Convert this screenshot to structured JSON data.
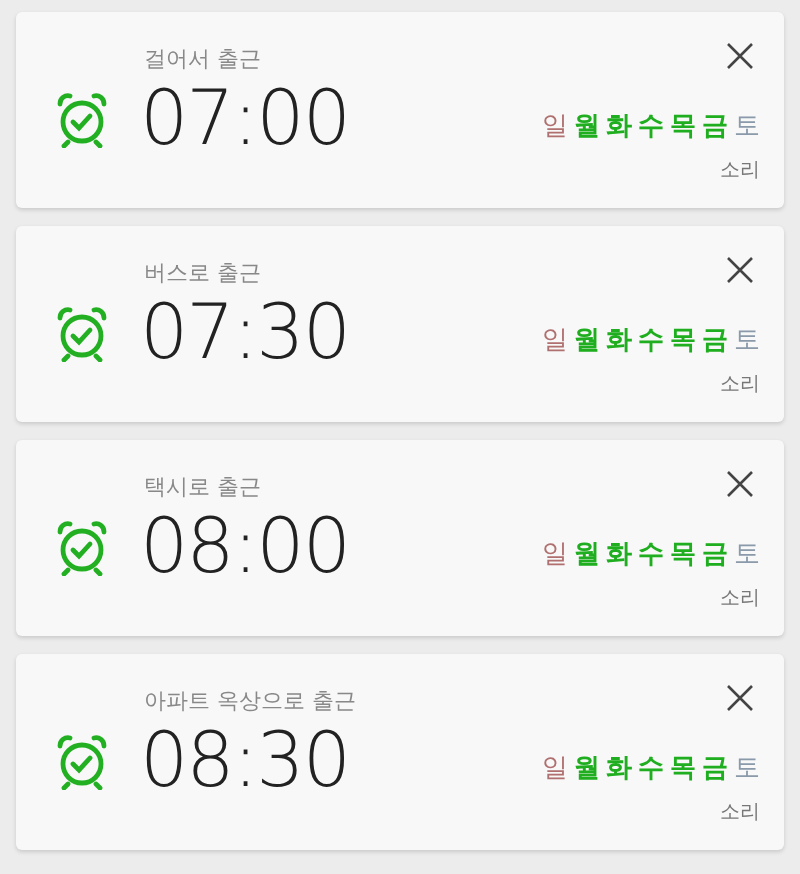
{
  "alarms": [
    {
      "label": "걸어서 출근",
      "time": "07:00",
      "sound": "소리",
      "days": [
        {
          "label": "일",
          "selected": false,
          "color": "#b07070"
        },
        {
          "label": "월",
          "selected": true
        },
        {
          "label": "화",
          "selected": true
        },
        {
          "label": "수",
          "selected": true
        },
        {
          "label": "목",
          "selected": true
        },
        {
          "label": "금",
          "selected": true
        },
        {
          "label": "토",
          "selected": false,
          "color": "#8a9aaa"
        }
      ]
    },
    {
      "label": "버스로 출근",
      "time": "07:30",
      "sound": "소리",
      "days": [
        {
          "label": "일",
          "selected": false,
          "color": "#b07070"
        },
        {
          "label": "월",
          "selected": true
        },
        {
          "label": "화",
          "selected": true
        },
        {
          "label": "수",
          "selected": true
        },
        {
          "label": "목",
          "selected": true
        },
        {
          "label": "금",
          "selected": true
        },
        {
          "label": "토",
          "selected": false,
          "color": "#8a9aaa"
        }
      ]
    },
    {
      "label": "택시로 출근",
      "time": "08:00",
      "sound": "소리",
      "days": [
        {
          "label": "일",
          "selected": false,
          "color": "#b07070"
        },
        {
          "label": "월",
          "selected": true
        },
        {
          "label": "화",
          "selected": true
        },
        {
          "label": "수",
          "selected": true
        },
        {
          "label": "목",
          "selected": true
        },
        {
          "label": "금",
          "selected": true
        },
        {
          "label": "토",
          "selected": false,
          "color": "#8a9aaa"
        }
      ]
    },
    {
      "label": "아파트 옥상으로 출근",
      "time": "08:30",
      "sound": "소리",
      "days": [
        {
          "label": "일",
          "selected": false,
          "color": "#b07070"
        },
        {
          "label": "월",
          "selected": true
        },
        {
          "label": "화",
          "selected": true
        },
        {
          "label": "수",
          "selected": true
        },
        {
          "label": "목",
          "selected": true
        },
        {
          "label": "금",
          "selected": true
        },
        {
          "label": "토",
          "selected": false,
          "color": "#8a9aaa"
        }
      ]
    }
  ]
}
